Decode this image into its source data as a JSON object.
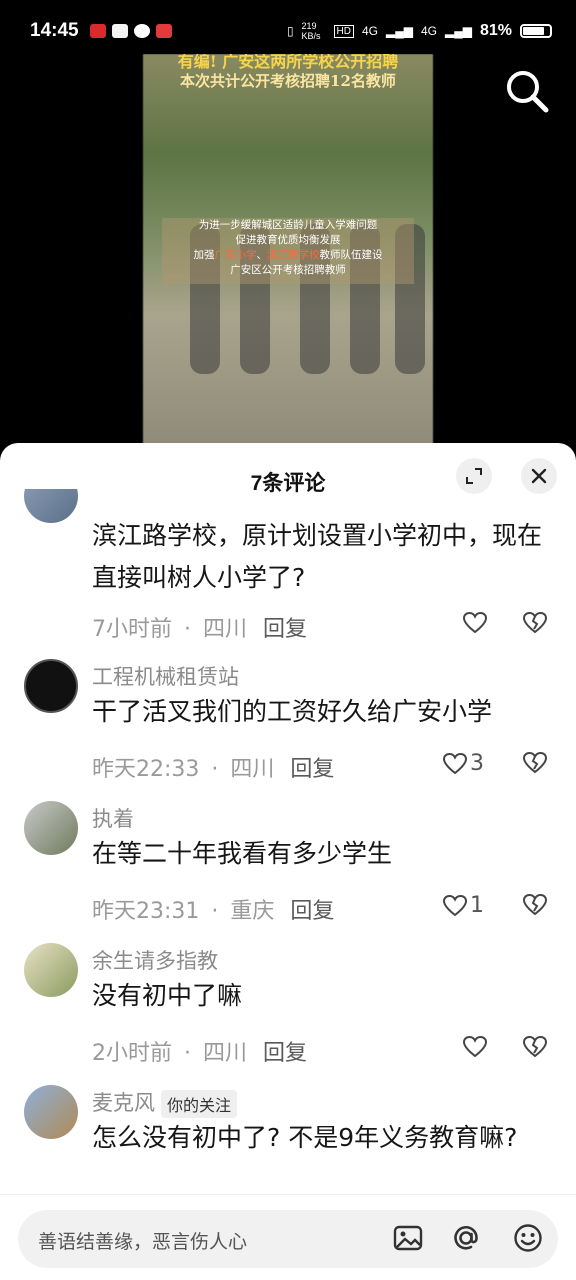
{
  "status_bar": {
    "time": "14:45",
    "speed": "219 KB/s",
    "network1": "4G",
    "network2": "4G",
    "battery": "81%",
    "battery_level": 0.81
  },
  "video": {
    "headline1": "有编! 广安这两所学校公开招聘",
    "headline2": "本次共计公开考核招聘12名教师",
    "caption_lines": [
      "为进一步缓解城区适龄儿童入学难问题",
      "促进教育优质均衡发展"
    ],
    "caption3_prefix": "加强",
    "caption3_hl1": "广安小学",
    "caption3_sep": "、",
    "caption3_hl2": "滨江路学校",
    "caption3_suffix": "教师队伍建设",
    "caption4": "广安区公开考核招聘教师"
  },
  "sheet": {
    "title": "7条评论"
  },
  "comments": [
    {
      "username": "",
      "text": "滨江路学校，原计划设置小学初中，现在直接叫树人小学了?",
      "time": "7小时前",
      "location": "四川",
      "reply": "回复",
      "likes": ""
    },
    {
      "username": "工程机械租赁站",
      "text": "干了活叉我们的工资好久给广安小学",
      "time": "昨天22:33",
      "location": "四川",
      "reply": "回复",
      "likes": "3"
    },
    {
      "username": "执着",
      "text": "在等二十年我看有多少学生",
      "time": "昨天23:31",
      "location": "重庆",
      "reply": "回复",
      "likes": "1"
    },
    {
      "username": "余生请多指教",
      "text": "没有初中了嘛",
      "time": "2小时前",
      "location": "四川",
      "reply": "回复",
      "likes": ""
    },
    {
      "username": "麦克风",
      "tag": "你的关注",
      "text": "怎么没有初中了? 不是9年义务教育嘛?",
      "time": "",
      "location": "",
      "reply": "",
      "likes": ""
    }
  ],
  "input": {
    "placeholder": "善语结善缘，恶言伤人心"
  },
  "icons": {
    "search": "search-icon",
    "expand": "expand-icon",
    "close": "close-icon",
    "like": "heart-icon",
    "dislike": "broken-heart-icon",
    "image": "image-icon",
    "mention": "at-icon",
    "emoji": "emoji-icon"
  }
}
